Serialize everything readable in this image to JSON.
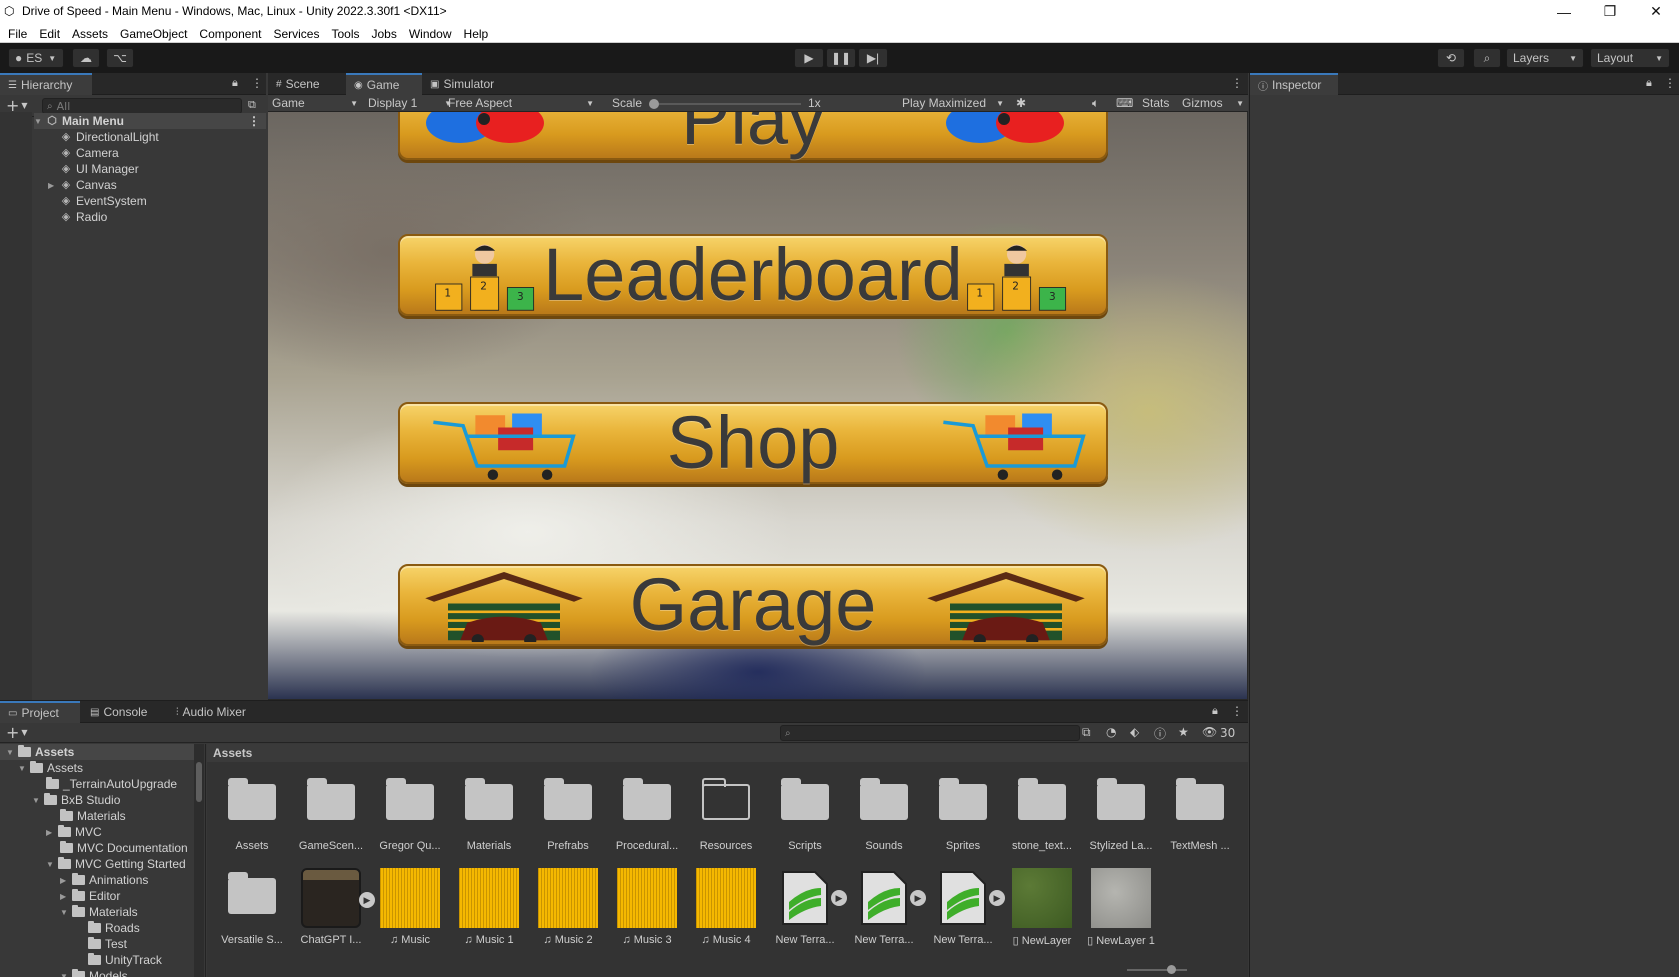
{
  "window": {
    "title": "Drive of Speed - Main Menu - Windows, Mac, Linux - Unity 2022.3.30f1 <DX11>"
  },
  "menu": [
    "File",
    "Edit",
    "Assets",
    "GameObject",
    "Component",
    "Services",
    "Tools",
    "Jobs",
    "Window",
    "Help"
  ],
  "toolbar": {
    "account": "ES",
    "layers": "Layers",
    "layout": "Layout"
  },
  "hierarchy": {
    "tab": "Hierarchy",
    "search_placeholder": "All",
    "scene": "Main Menu",
    "items": [
      "DirectionalLight",
      "Camera",
      "UI Manager",
      "Canvas",
      "EventSystem",
      "Radio"
    ]
  },
  "view_tabs": [
    "Scene",
    "Game",
    "Simulator"
  ],
  "game_bar": {
    "view": "Game",
    "display": "Display 1",
    "aspect": "Free Aspect",
    "scale_label": "Scale",
    "scale_value": "1x",
    "play_mode": "Play Maximized",
    "stats": "Stats",
    "gizmos": "Gizmos"
  },
  "game_buttons": [
    "Play",
    "Leaderboard",
    "Shop",
    "Garage"
  ],
  "inspector": {
    "tab": "Inspector"
  },
  "bottom_tabs": [
    "Project",
    "Console",
    "Audio Mixer"
  ],
  "project": {
    "count": "30",
    "breadcrumb": "Assets",
    "tree": [
      {
        "label": "Assets",
        "indent": 0
      },
      {
        "label": "Assets",
        "indent": 1
      },
      {
        "label": "_TerrainAutoUpgrade",
        "indent": 2
      },
      {
        "label": "BxB Studio",
        "indent": 1
      },
      {
        "label": "Materials",
        "indent": 2
      },
      {
        "label": "MVC",
        "indent": 2
      },
      {
        "label": "MVC Documentation",
        "indent": 2
      },
      {
        "label": "MVC Getting Started",
        "indent": 2
      },
      {
        "label": "Animations",
        "indent": 3
      },
      {
        "label": "Editor",
        "indent": 3
      },
      {
        "label": "Materials",
        "indent": 3
      },
      {
        "label": "Roads",
        "indent": 4
      },
      {
        "label": "Test",
        "indent": 4
      },
      {
        "label": "UnityTrack",
        "indent": 4
      },
      {
        "label": "Models",
        "indent": 3
      }
    ],
    "assets_row1": [
      "Assets",
      "GameScen...",
      "Gregor Qu...",
      "Materials",
      "Prefrabs",
      "Procedural...",
      "Resources",
      "Scripts",
      "Sounds",
      "Sprites",
      "stone_text...",
      "Stylized La...",
      "TextMesh ..."
    ],
    "assets_row2": [
      {
        "name": "Versatile S...",
        "kind": "folder"
      },
      {
        "name": "ChatGPT I...",
        "kind": "radio"
      },
      {
        "name": "Music",
        "kind": "audio"
      },
      {
        "name": "Music 1",
        "kind": "audio"
      },
      {
        "name": "Music 2",
        "kind": "audio"
      },
      {
        "name": "Music 3",
        "kind": "audio"
      },
      {
        "name": "Music 4",
        "kind": "audio"
      },
      {
        "name": "New Terra...",
        "kind": "terrain"
      },
      {
        "name": "New Terra...",
        "kind": "terrain"
      },
      {
        "name": "New Terra...",
        "kind": "terrain"
      },
      {
        "name": "NewLayer",
        "kind": "grass"
      },
      {
        "name": "NewLayer 1",
        "kind": "stone"
      }
    ]
  },
  "colors": {
    "accent": "#3a79bb",
    "button_gold": "#e9b43a",
    "audio_yellow": "#f5b800"
  }
}
